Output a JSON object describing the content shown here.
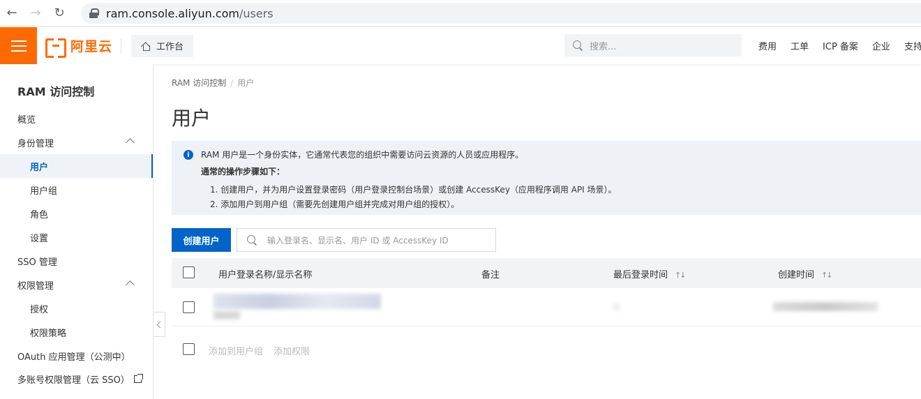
{
  "browser": {
    "url_host": "ram.console.aliyun.com",
    "url_path": "/users"
  },
  "header": {
    "logo_text": "阿里云",
    "workbench_label": "工作台",
    "search_placeholder": "搜索...",
    "links": [
      "费用",
      "工单",
      "ICP 备案",
      "企业",
      "支持"
    ],
    "accent_color": "#ff6a00"
  },
  "sidebar": {
    "title": "RAM 访问控制",
    "items": [
      {
        "label": "概览",
        "level": 1
      },
      {
        "label": "身份管理",
        "level": 1,
        "expanded": true
      },
      {
        "label": "用户",
        "level": 2,
        "active": true
      },
      {
        "label": "用户组",
        "level": 2
      },
      {
        "label": "角色",
        "level": 2
      },
      {
        "label": "设置",
        "level": 2
      },
      {
        "label": "SSO 管理",
        "level": 1
      },
      {
        "label": "权限管理",
        "level": 1,
        "expanded": true
      },
      {
        "label": "授权",
        "level": 2
      },
      {
        "label": "权限策略",
        "level": 2
      },
      {
        "label": "OAuth 应用管理（公测中）",
        "level": 1
      },
      {
        "label": "多账号权限管理（云 SSO）",
        "level": 1,
        "external": true
      }
    ]
  },
  "breadcrumb": {
    "root": "RAM 访问控制",
    "separator": "/",
    "current": "用户"
  },
  "page_title": "用户",
  "notice": {
    "intro": "RAM 用户是一个身份实体，它通常代表您的组织中需要访问云资源的人员或应用程序。",
    "heading": "通常的操作步骤如下：",
    "steps": [
      "1. 创建用户，并为用户设置登录密码（用户登录控制台场景）或创建 AccessKey（应用程序调用 API 场景）。",
      "2. 添加用户到用户组（需要先创建用户组并完成对用户组的授权）。"
    ]
  },
  "toolbar": {
    "create_label": "创建用户",
    "search_placeholder": "输入登录名、显示名、用户 ID 或 AccessKey ID"
  },
  "table": {
    "columns": [
      "用户登录名称/显示名称",
      "备注",
      "最后登录时间",
      "创建时间"
    ],
    "sort_glyph": "↑↓"
  },
  "bulk_actions": [
    "添加到用户组",
    "添加权限"
  ],
  "colors": {
    "primary": "#0064c8",
    "notice_bg": "#eef2f7"
  }
}
